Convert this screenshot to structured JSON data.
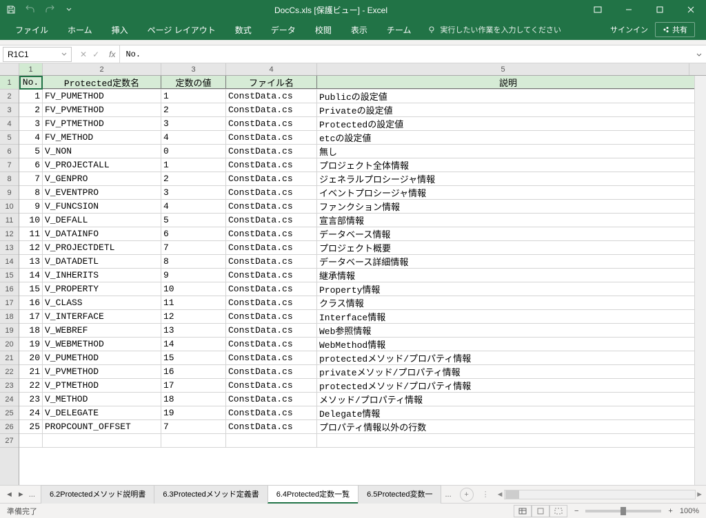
{
  "title": "DocCs.xls [保護ビュー] - Excel",
  "ribbon": {
    "tabs": [
      "ファイル",
      "ホーム",
      "挿入",
      "ページ レイアウト",
      "数式",
      "データ",
      "校閲",
      "表示",
      "チーム"
    ],
    "tell_me": "実行したい作業を入力してください",
    "signin": "サインイン",
    "share": "共有"
  },
  "namebox": "R1C1",
  "formula": "No.",
  "columns": [
    "1",
    "2",
    "3",
    "4",
    "5"
  ],
  "headers": [
    "No.",
    "Protected定数名",
    "定数の値",
    "ファイル名",
    "説明"
  ],
  "rows": [
    {
      "no": "1",
      "name": "FV_PUMETHOD",
      "val": "1",
      "file": "ConstData.cs",
      "desc": "Publicの設定値"
    },
    {
      "no": "2",
      "name": "FV_PVMETHOD",
      "val": "2",
      "file": "ConstData.cs",
      "desc": "Privateの設定値"
    },
    {
      "no": "3",
      "name": "FV_PTMETHOD",
      "val": "3",
      "file": "ConstData.cs",
      "desc": "Protectedの設定値"
    },
    {
      "no": "4",
      "name": "FV_METHOD",
      "val": "4",
      "file": "ConstData.cs",
      "desc": "etcの設定値"
    },
    {
      "no": "5",
      "name": "V_NON",
      "val": "0",
      "file": "ConstData.cs",
      "desc": "無し"
    },
    {
      "no": "6",
      "name": "V_PROJECTALL",
      "val": "1",
      "file": "ConstData.cs",
      "desc": "プロジェクト全体情報"
    },
    {
      "no": "7",
      "name": "V_GENPRO",
      "val": "2",
      "file": "ConstData.cs",
      "desc": "ジェネラルプロシージャ情報"
    },
    {
      "no": "8",
      "name": "V_EVENTPRO",
      "val": "3",
      "file": "ConstData.cs",
      "desc": "イベントプロシージャ情報"
    },
    {
      "no": "9",
      "name": "V_FUNCSION",
      "val": "4",
      "file": "ConstData.cs",
      "desc": "ファンクション情報"
    },
    {
      "no": "10",
      "name": "V_DEFALL",
      "val": "5",
      "file": "ConstData.cs",
      "desc": "宣言部情報"
    },
    {
      "no": "11",
      "name": "V_DATAINFO",
      "val": "6",
      "file": "ConstData.cs",
      "desc": "データベース情報"
    },
    {
      "no": "12",
      "name": "V_PROJECTDETL",
      "val": "7",
      "file": "ConstData.cs",
      "desc": "プロジェクト概要"
    },
    {
      "no": "13",
      "name": "V_DATADETL",
      "val": "8",
      "file": "ConstData.cs",
      "desc": "データベース詳細情報"
    },
    {
      "no": "14",
      "name": "V_INHERITS",
      "val": "9",
      "file": "ConstData.cs",
      "desc": "継承情報"
    },
    {
      "no": "15",
      "name": "V_PROPERTY",
      "val": "10",
      "file": "ConstData.cs",
      "desc": "Property情報"
    },
    {
      "no": "16",
      "name": "V_CLASS",
      "val": "11",
      "file": "ConstData.cs",
      "desc": "クラス情報"
    },
    {
      "no": "17",
      "name": "V_INTERFACE",
      "val": "12",
      "file": "ConstData.cs",
      "desc": "Interface情報"
    },
    {
      "no": "18",
      "name": "V_WEBREF",
      "val": "13",
      "file": "ConstData.cs",
      "desc": "Web参照情報"
    },
    {
      "no": "19",
      "name": "V_WEBMETHOD",
      "val": "14",
      "file": "ConstData.cs",
      "desc": "WebMethod情報"
    },
    {
      "no": "20",
      "name": "V_PUMETHOD",
      "val": "15",
      "file": "ConstData.cs",
      "desc": "protectedメソッド/プロパティ情報"
    },
    {
      "no": "21",
      "name": "V_PVMETHOD",
      "val": "16",
      "file": "ConstData.cs",
      "desc": "privateメソッド/プロパティ情報"
    },
    {
      "no": "22",
      "name": "V_PTMETHOD",
      "val": "17",
      "file": "ConstData.cs",
      "desc": "protectedメソッド/プロパティ情報"
    },
    {
      "no": "23",
      "name": "V_METHOD",
      "val": "18",
      "file": "ConstData.cs",
      "desc": "メソッド/プロパティ情報"
    },
    {
      "no": "24",
      "name": "V_DELEGATE",
      "val": "19",
      "file": "ConstData.cs",
      "desc": "Delegate情報"
    },
    {
      "no": "25",
      "name": "PROPCOUNT_OFFSET",
      "val": "7",
      "file": "ConstData.cs",
      "desc": "プロパティ情報以外の行数"
    }
  ],
  "sheets": {
    "ellipsis": "...",
    "tabs": [
      "6.2Protectedメソッド説明書",
      "6.3Protectedメソッド定義書",
      "6.4Protected定数一覧",
      "6.5Protected変数一"
    ],
    "active_index": 2,
    "more": "..."
  },
  "status": {
    "ready": "準備完了",
    "zoom": "100%"
  }
}
